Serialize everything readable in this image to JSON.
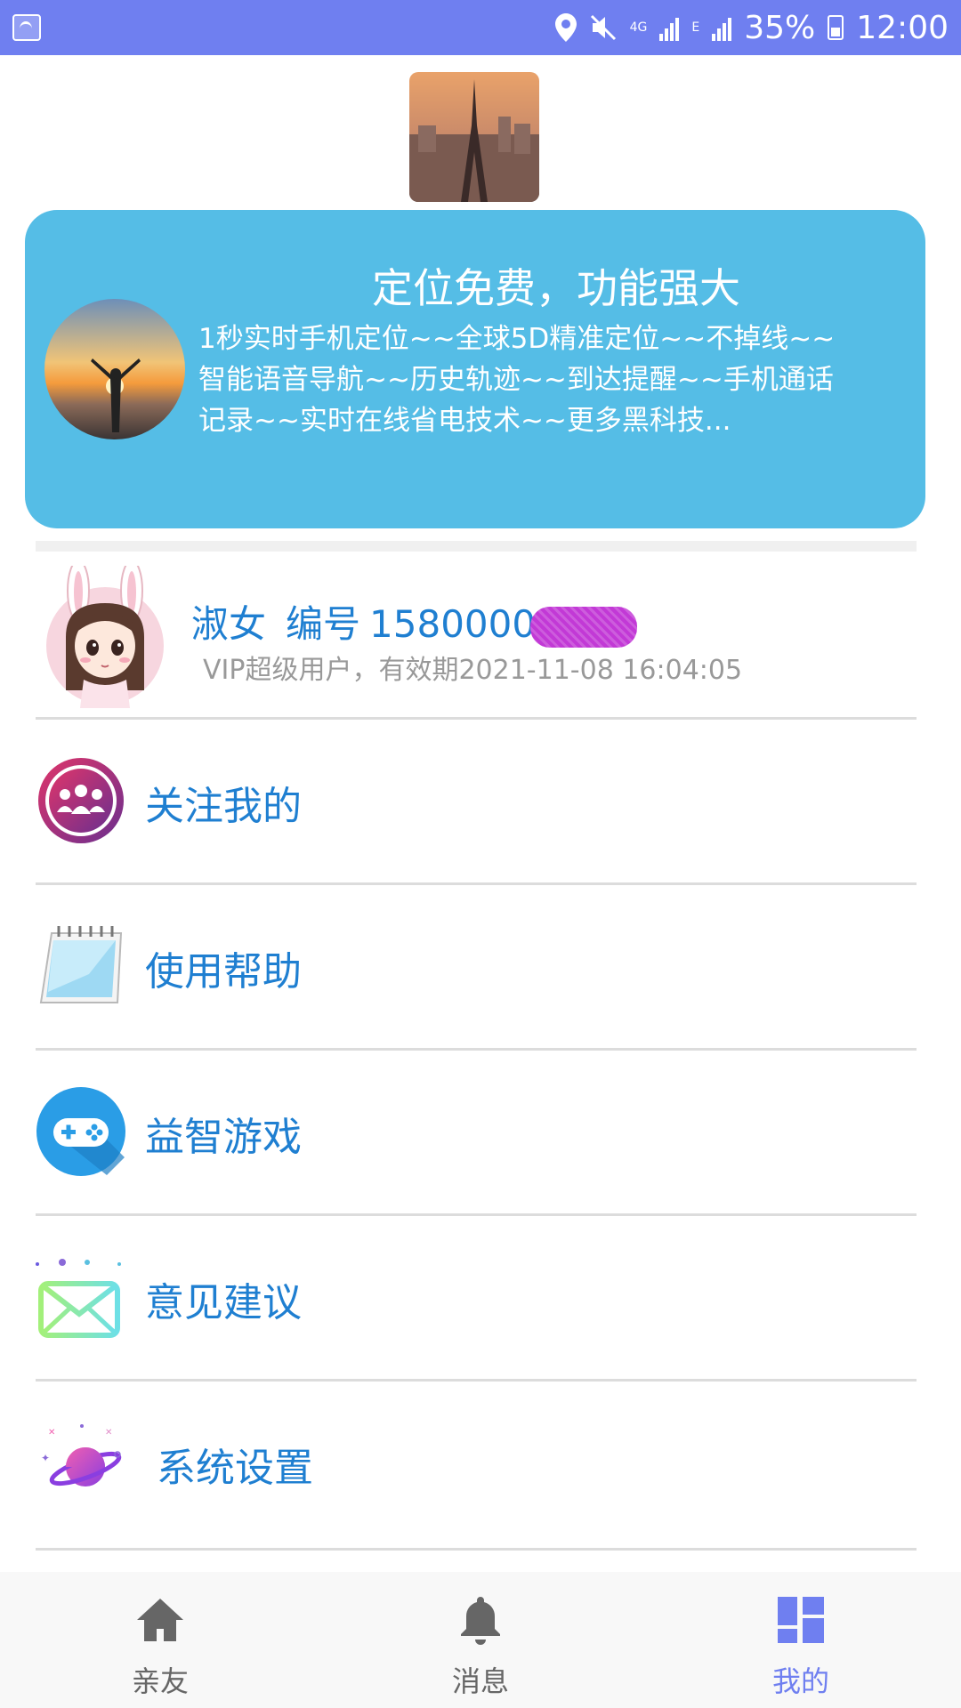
{
  "status_bar": {
    "network": "4G",
    "network_sub": "E",
    "battery": "35%",
    "time": "12:00"
  },
  "promo": {
    "title": "定位免费，功能强大",
    "description": "1秒实时手机定位~~全球5D精准定位~~不掉线~~智能语音导航~~历史轨迹~~到达提醒~~手机通话记录~~实时在线省电技术~~更多黑科技..."
  },
  "profile": {
    "name": "淑女",
    "id_label": "编号",
    "id_value": "1580000",
    "subtitle": "VIP超级用户，有效期2021-11-08 16:04:05"
  },
  "menu": [
    {
      "label": "关注我的",
      "icon": "followers-icon"
    },
    {
      "label": "使用帮助",
      "icon": "notepad-icon"
    },
    {
      "label": "益智游戏",
      "icon": "gamepad-icon"
    },
    {
      "label": "意见建议",
      "icon": "envelope-icon"
    },
    {
      "label": "系统设置",
      "icon": "planet-icon"
    }
  ],
  "bottom_nav": [
    {
      "label": "亲友",
      "icon": "home-icon",
      "active": false
    },
    {
      "label": "消息",
      "icon": "bell-icon",
      "active": false
    },
    {
      "label": "我的",
      "icon": "grid-icon",
      "active": true
    }
  ],
  "colors": {
    "status_bar": "#6f7ff0",
    "promo_card": "#55bde6",
    "accent_text": "#1f7fd1",
    "nav_inactive": "#666666",
    "nav_active": "#6f7ff0"
  }
}
